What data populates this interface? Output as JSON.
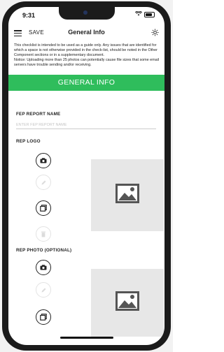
{
  "status_bar": {
    "time": "9:31"
  },
  "navbar": {
    "save_label": "SAVE",
    "title": "General Info"
  },
  "notice": {
    "paragraph": "This checklist is intended to be used as a guide only. Any issues that are identified for which a space is not otherwise provided in the check-list, should be noted in the Other Component sections or in a supplementary document.",
    "warning": "Notice: Uploading more than 25 photos can potentially cause file sizes that some email servers have trouble sending and/or receiving."
  },
  "section": {
    "title": "GENERAL INFO"
  },
  "fep_report_name": {
    "label": "FEP REPORT NAME",
    "placeholder": "ENTER FEP REPORT NAME",
    "value": ""
  },
  "rep_logo": {
    "label": "REP LOGO"
  },
  "rep_photo": {
    "label": "REP PHOTO (OPTIONAL)"
  },
  "colors": {
    "accent": "#2fbd5c",
    "placeholder_bg": "#e7e7e7",
    "disabled_border": "#e3e3e3"
  },
  "icons": [
    "menu-icon",
    "gear-icon",
    "camera-icon",
    "pencil-icon",
    "gallery-icon",
    "trash-icon",
    "image-icon"
  ]
}
